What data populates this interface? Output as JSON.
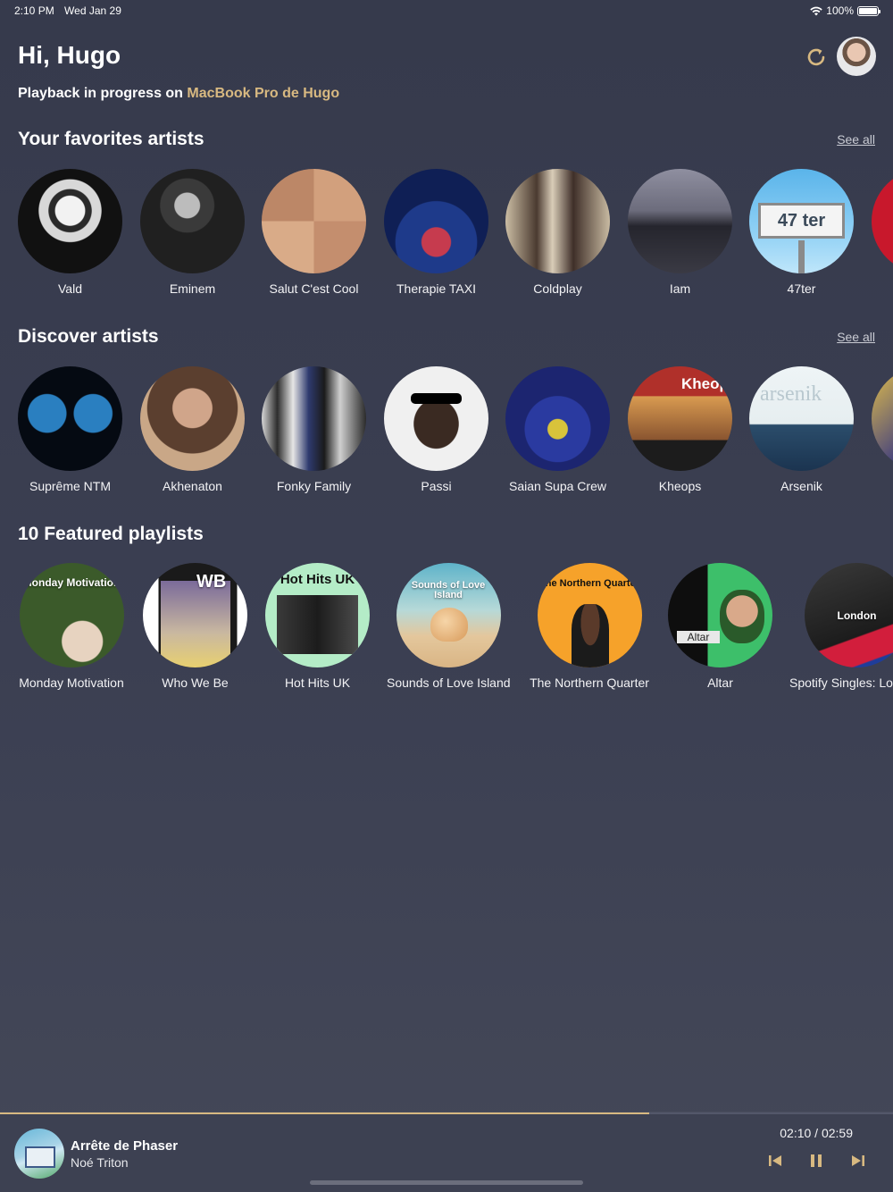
{
  "status_bar": {
    "time": "2:10 PM",
    "date": "Wed Jan 29",
    "battery": "100%"
  },
  "header": {
    "greeting": "Hi, Hugo",
    "playback_prefix": "Playback in progress on",
    "playback_device": "MacBook Pro de Hugo",
    "refresh_icon": "refresh-icon",
    "accent_color": "#d8b981"
  },
  "favorites": {
    "title": "Your favorites artists",
    "see_all": "See all",
    "items": [
      {
        "label": "Vald"
      },
      {
        "label": "Eminem"
      },
      {
        "label": "Salut C'est Cool"
      },
      {
        "label": "Therapie TAXI"
      },
      {
        "label": "Coldplay"
      },
      {
        "label": "Iam"
      },
      {
        "label": "47ter",
        "art_text": "47 ter"
      }
    ]
  },
  "discover": {
    "title": "Discover artists",
    "see_all": "See all",
    "items": [
      {
        "label": "Suprême NTM"
      },
      {
        "label": "Akhenaton"
      },
      {
        "label": "Fonky Family"
      },
      {
        "label": "Passi"
      },
      {
        "label": "Saian Supa Crew"
      },
      {
        "label": "Kheops",
        "art_text": "Kheop"
      },
      {
        "label": "Arsenik",
        "art_text": "arsenik"
      }
    ]
  },
  "playlists": {
    "title": "10 Featured playlists",
    "items": [
      {
        "label": "Monday Motivation",
        "art_text": "Monday Motivation"
      },
      {
        "label": "Who We Be",
        "art_text": "WB"
      },
      {
        "label": "Hot Hits UK",
        "art_text": "Hot Hits UK"
      },
      {
        "label": "Sounds of Love Island",
        "art_text": "Sounds of Love Island"
      },
      {
        "label": "The Northern Quarter",
        "art_text": "The Northern Quarter"
      },
      {
        "label": "Altar",
        "art_text": "Altar"
      },
      {
        "label": "Spotify Singles: Lo",
        "art_text": "London"
      }
    ]
  },
  "now_playing": {
    "title": "Arrête de Phaser",
    "artist": "Noé Triton",
    "time": "02:10 / 02:59",
    "progress": 0.727,
    "controls": [
      "previous-icon",
      "pause-icon",
      "next-icon"
    ]
  }
}
